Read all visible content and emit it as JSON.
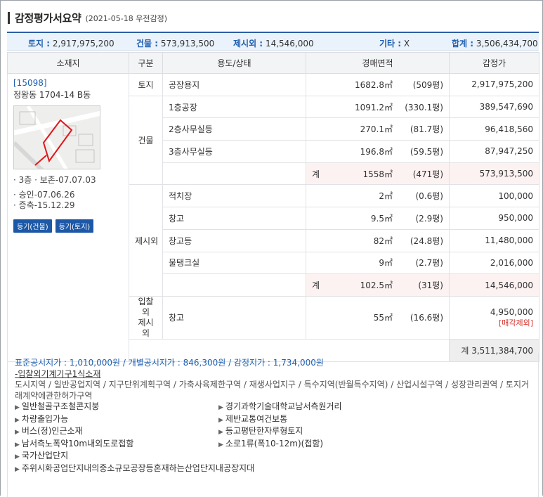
{
  "title": {
    "main": "감정평가서요약",
    "sub": "(2021-05-18  우전감정)"
  },
  "summary": {
    "land_label": "토지 :",
    "land_value": "2,917,975,200",
    "bldg_label": "건물 :",
    "bldg_value": "573,913,500",
    "excl_label": "제시외 :",
    "excl_value": "14,546,000",
    "other_label": "기타 :",
    "other_value": "X",
    "total_label": "합계 :",
    "total_value": "3,506,434,700"
  },
  "headers": [
    "소재지",
    "구분",
    "용도/상태",
    "경매면적",
    "감정가"
  ],
  "location": {
    "code": "[15098]",
    "address": "정왕동 1704-14 B동",
    "info": [
      "· 3층  · 보존-07.07.03",
      "· 승인-07.06.26",
      "· 증축-15.12.29"
    ],
    "buttons": [
      "등기(건물)",
      "등기(토지)"
    ]
  },
  "groups": {
    "land": "토지",
    "building": "건물",
    "excluded": "제시외",
    "bid_excluded": "입찰외\n제시외"
  },
  "rows": [
    {
      "use": "공장용지",
      "area": "1682.8㎡",
      "pyeong": "(509평)",
      "price": "2,917,975,200"
    },
    {
      "use": "1층공장",
      "area": "1091.2㎡",
      "pyeong": "(330.1평)",
      "price": "389,547,690"
    },
    {
      "use": "2층사무실등",
      "area": "270.1㎡",
      "pyeong": "(81.7평)",
      "price": "96,418,560"
    },
    {
      "use": "3층사무실등",
      "area": "196.8㎡",
      "pyeong": "(59.5평)",
      "price": "87,947,250"
    },
    {
      "use": "",
      "sum_label": "계",
      "area": "1558㎡",
      "pyeong": "(471평)",
      "price": "573,913,500"
    },
    {
      "use": "적치장",
      "area": "2㎡",
      "pyeong": "(0.6평)",
      "price": "100,000"
    },
    {
      "use": "창고",
      "area": "9.5㎡",
      "pyeong": "(2.9평)",
      "price": "950,000"
    },
    {
      "use": "창고등",
      "area": "82㎡",
      "pyeong": "(24.8평)",
      "price": "11,480,000"
    },
    {
      "use": "물탱크실",
      "area": "9㎡",
      "pyeong": "(2.7평)",
      "price": "2,016,000"
    },
    {
      "use": "",
      "sum_label": "계",
      "area": "102.5㎡",
      "pyeong": "(31평)",
      "price": "14,546,000"
    },
    {
      "use": "창고",
      "area": "55㎡",
      "pyeong": "(16.6평)",
      "price": "4,950,000",
      "note": "[매각제외]"
    }
  ],
  "grand_total": "계 3,511,384,700",
  "notes": {
    "prices": "표준공시지가 : 1,010,000원 / 개별공시지가 : 846,300원 / 감정지가 : 1,734,000원",
    "underline": "-입찰외기계기구1식소재",
    "zoning": "도시지역 / 일반공업지역 / 지구단위계획구역 / 가축사육제한구역 / 재생사업지구 / 특수지역(반월특수지역) / 산업시설구역 / 성장관리권역 / 토지거래계약에관한허가구역",
    "bullets": [
      "일반철골구조철콘지붕",
      "경기과학기술대학교남서측원거리",
      "차량출입가능",
      "제반교통여건보통",
      "버스(정)인근소재",
      "등고평탄한자루형토지",
      "남서측노폭약10m내외도로접함",
      "소로1류(폭10-12m)(접함)",
      "국가산업단지",
      "",
      "주위시화공업단지내의중소규모공장등혼재하는산업단지내공장지대",
      ""
    ]
  }
}
